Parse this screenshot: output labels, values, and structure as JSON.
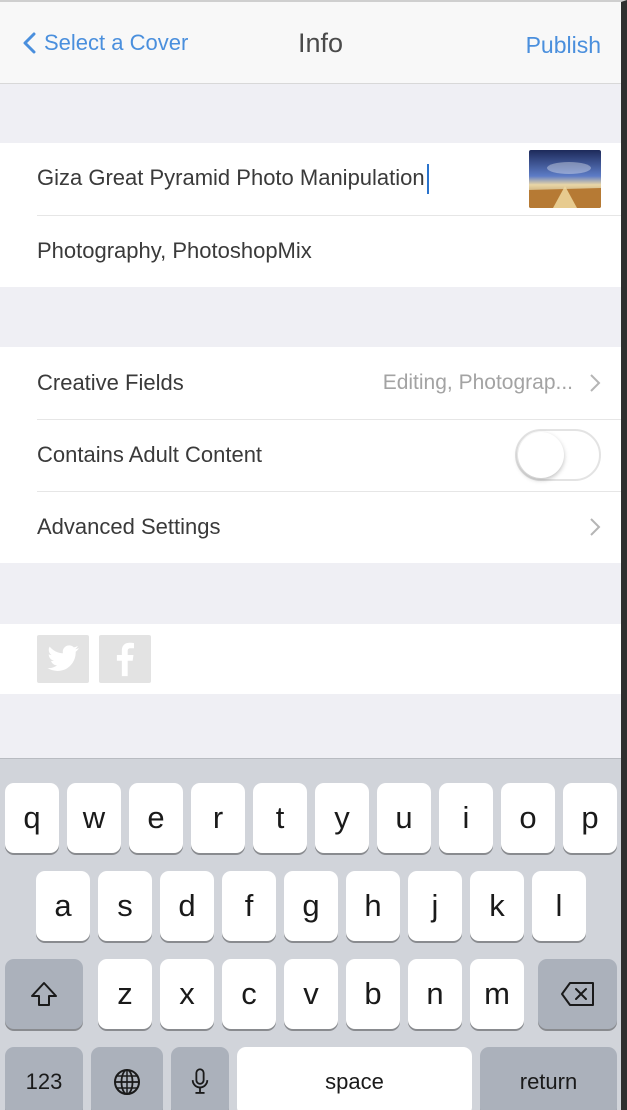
{
  "navbar": {
    "back_label": "Select a Cover",
    "title": "Info",
    "publish_label": "Publish"
  },
  "project": {
    "title_value": "Giza Great Pyramid Photo Manipulation",
    "tags_value": "Photography, PhotoshopMix"
  },
  "settings": {
    "creative_fields_label": "Creative Fields",
    "creative_fields_value": "Editing, Photograp...",
    "adult_content_label": "Contains Adult Content",
    "adult_content_on": false,
    "advanced_label": "Advanced Settings"
  },
  "social": {
    "icons": [
      "twitter-icon",
      "facebook-icon"
    ]
  },
  "keyboard": {
    "row1": [
      "q",
      "w",
      "e",
      "r",
      "t",
      "y",
      "u",
      "i",
      "o",
      "p"
    ],
    "row2": [
      "a",
      "s",
      "d",
      "f",
      "g",
      "h",
      "j",
      "k",
      "l"
    ],
    "row3": [
      "z",
      "x",
      "c",
      "v",
      "b",
      "n",
      "m"
    ],
    "numbers_label": "123",
    "space_label": "space",
    "return_label": "return"
  },
  "colors": {
    "accent": "#4a8fdd",
    "background": "#efeff4",
    "keyboard": "#d1d4da"
  }
}
